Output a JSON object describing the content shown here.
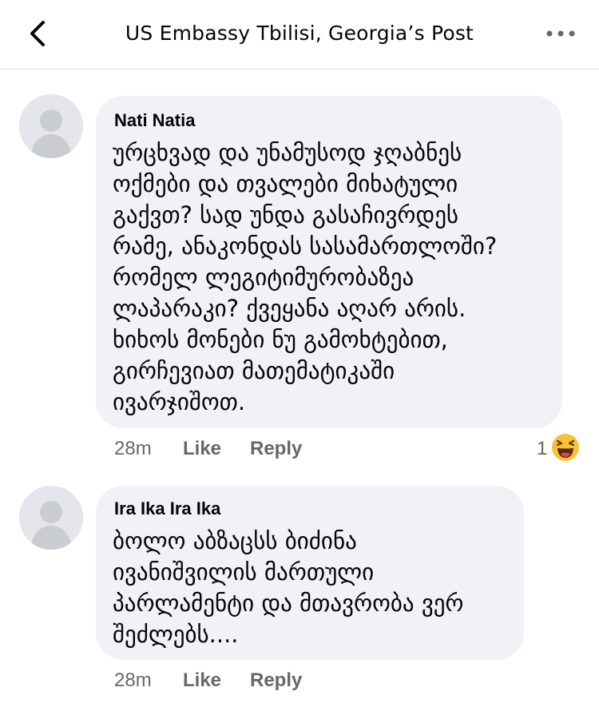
{
  "header": {
    "title": "US Embassy Tbilisi, Georgia’s Post",
    "back_icon": "chevron-left-icon",
    "more_icon": "more-horizontal-icon"
  },
  "comments": [
    {
      "author": "Nati Natia",
      "text": "ურცხვად და უნამუსოდ ჯღაბნეს\nოქმები და თვალები მიხატული\nგაქვთ? სად უნდა გასაჩივრდეს\nრამე, ანაკონდას სასამართლოში?\nრომელ ლეგიტიმურობაზეა\nლაპარაკი? ქვეყანა აღარ არის.\nხიხოს მონები ნუ გამოხტებით,\nგირჩევიათ მათემატიკაში\nივარჯიშოთ.",
      "time": "28m",
      "like_label": "Like",
      "reply_label": "Reply",
      "reaction_count": "1",
      "reaction_icon": "laughing-emoji-icon"
    },
    {
      "author": "Ira Ika Ira Ika",
      "text": "ბოლო აბზაცსს ბიძინა\nივანიშვილის მართული\nპარლამენტი და მთავრობა ვერ\nშეძლებს....",
      "time": "28m",
      "like_label": "Like",
      "reply_label": "Reply"
    }
  ],
  "colors": {
    "bubble": "#f0f2f5",
    "meta_text": "#65676b",
    "avatar_bg": "#e4e6eb",
    "avatar_fg": "#c9ccd1",
    "reaction_yellow": "#f7c238"
  }
}
